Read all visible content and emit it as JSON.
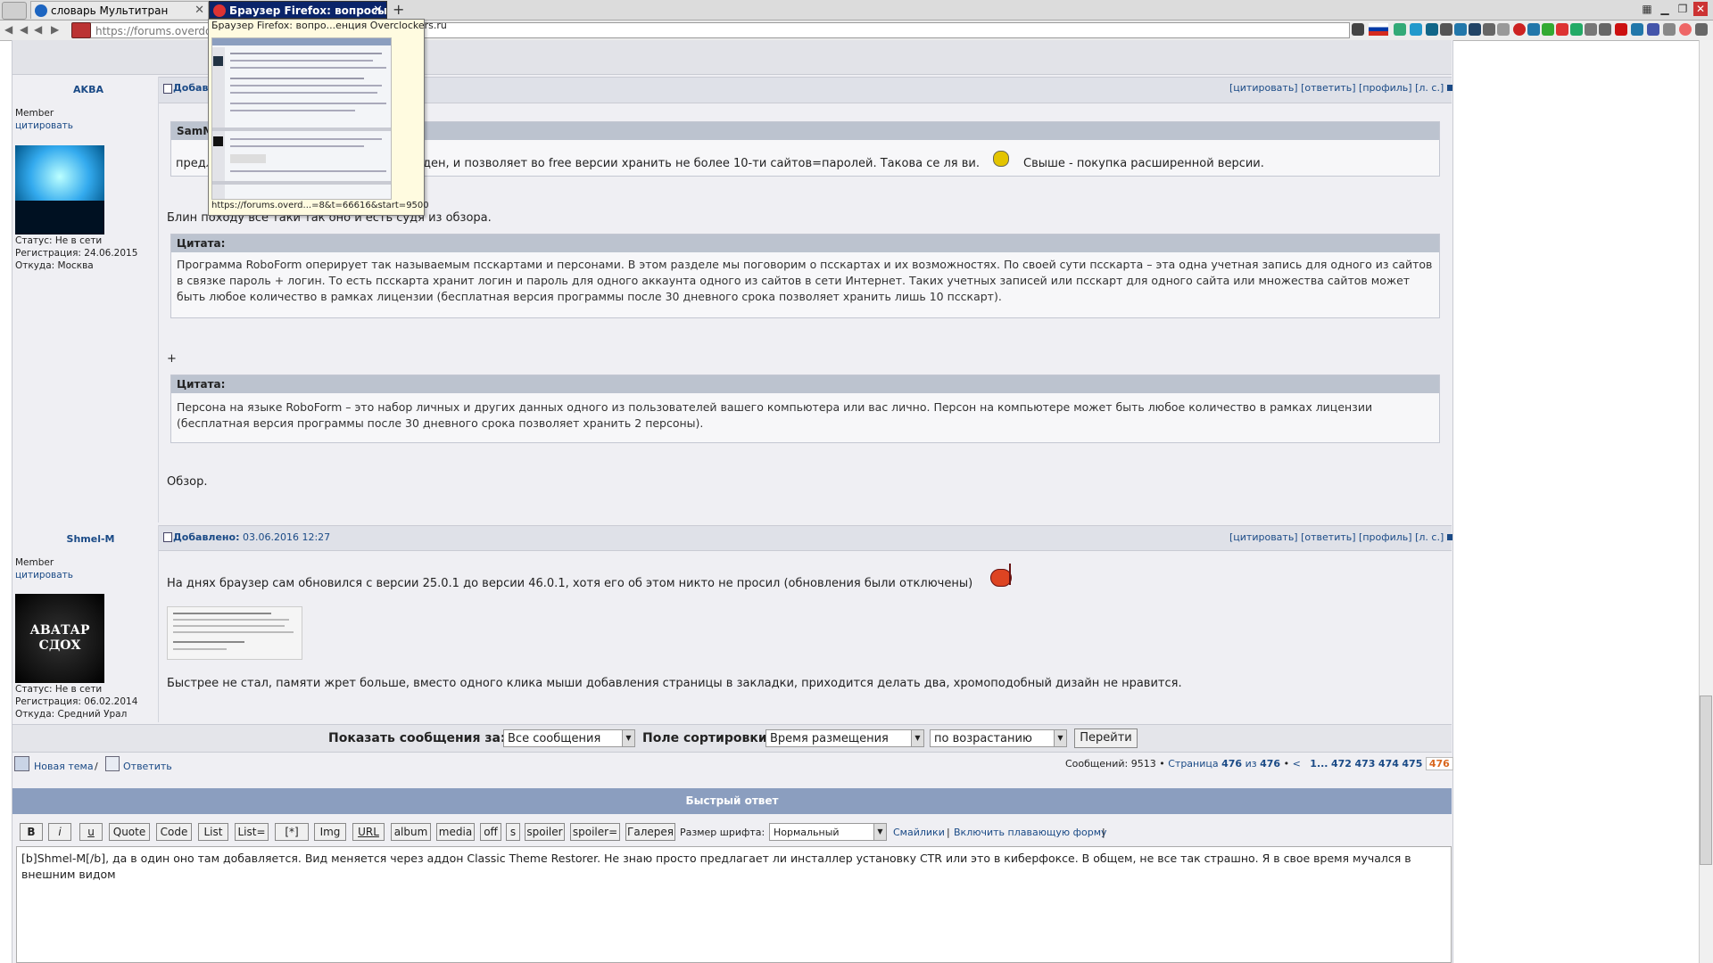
{
  "tabs": [
    {
      "label": "словарь Мультитран"
    },
    {
      "label": "Браузер Firefox: вопросы..."
    }
  ],
  "window_controls": {
    "new_tab": "+"
  },
  "navbar": {
    "url": "https://forums.overdockers.ru"
  },
  "tooltip": {
    "title": "Браузер Firefox: вопро...енция Overclockers.ru",
    "url": "https://forums.overd...=8&t=66616&start=9500"
  },
  "post_actions": {
    "quote": "[цитировать]",
    "reply": "[ответить]",
    "profile": "[профиль]",
    "pm": "[л. с.]"
  },
  "post1": {
    "author": "AKBA",
    "rank": "Member",
    "quote_link": "цитировать",
    "status": "Статус: Не в сети",
    "reg": "Регистрация: 24.06.2015",
    "from": "Откуда: Москва",
    "added_prefix": "Добавл",
    "quote0_head": "SamM",
    "quote0_body_left": "предл",
    "quote0_body_right": "ден, и позволяет во free версии хранить не более 10-ти сайтов=паролей. Такова се ля ви.",
    "quote0_body_tail": "Свыше - покупка расширенной версии.",
    "line1": "Блин походу все таки так оно и есть судя из обзора.",
    "quote_label": "Цитата:",
    "quote1": "Программа RoboForm оперирует так называемым псскартами и персонами. В этом разделе мы поговорим о псскартах и их возможностях. По своей сути псскарта – эта одна учетная запись для одного из сайтов в связке пароль + логин. То есть псскарта хранит логин и пароль для одного аккаунта одного из сайтов в сети Интернет. Таких учетных записей или псскарт для одного сайта или множества сайтов может быть любое количество в рамках лицензии (бесплатная версия программы после 30 дневного срока позволяет хранить лишь 10 псскарт).",
    "plus": "+",
    "quote2": "Персона на языке RoboForm – это набор личных и других данных одного из пользователей вашего компьютера или вас лично. Персон на компьютере может быть любое количество в рамках лицензии (бесплатная версия программы после 30 дневного срока позволяет хранить 2 персоны).",
    "review_link": "Обзор."
  },
  "post2": {
    "author": "Shmel-M",
    "rank": "Member",
    "quote_link": "цитировать",
    "avatar_text": "АВАТАР СДОХ",
    "status": "Статус: Не в сети",
    "reg": "Регистрация: 06.02.2014",
    "from": "Откуда: Средний Урал",
    "added_label": "Добавлено:",
    "added_date": "03.06.2016 12:27",
    "line1": "На днях браузер сам обновился с версии 25.0.1 до версии 46.0.1, хотя его об этом никто не просил (обновления были отключены)",
    "line2": "Быстрее не стал, памяти жрет больше, вместо одного клика мыши добавления страницы в закладки, приходится делать два, хромоподобный дизайн не нравится."
  },
  "sortbar": {
    "show_label": "Показать сообщения за:",
    "show_value": "Все сообщения",
    "sort_label": "Поле сортировки",
    "sort_value": "Время размещения",
    "order_value": "по возрастанию",
    "go": "Перейти"
  },
  "footer": {
    "new_topic": "Новая тема",
    "sep": "/",
    "reply": "Ответить",
    "messages": "Сообщений: 9513 •",
    "page_word": "Страница",
    "page_current": "476",
    "page_of": "из",
    "page_total": "476",
    "dot": "•",
    "prev": "<",
    "pages": [
      "1",
      "...",
      "472",
      "473",
      "474",
      "475"
    ],
    "active_page": "476"
  },
  "quick_reply": {
    "title": "Быстрый ответ",
    "buttons": [
      "B",
      "i",
      "u",
      "Quote",
      "Code",
      "List",
      "List=",
      "[*]",
      "Img",
      "URL",
      "album",
      "media",
      "off",
      "s",
      "spoiler",
      "spoiler=",
      "Галерея"
    ],
    "font_size_label": "Размер шрифта:",
    "font_size_value": "Нормальный",
    "smilies": "Смайлики",
    "float_form": "Включить плавающую форму",
    "pipe": "|",
    "text": "[b]Shmel-M[/b], да в один оно там добавляется. Вид меняется через аддон Classic Theme Restorer. Не знаю просто предлагает ли инсталлер установку CTR или это в киберфоксе. В общем, не все так страшно. Я в свое время мучался в внешним видом"
  }
}
